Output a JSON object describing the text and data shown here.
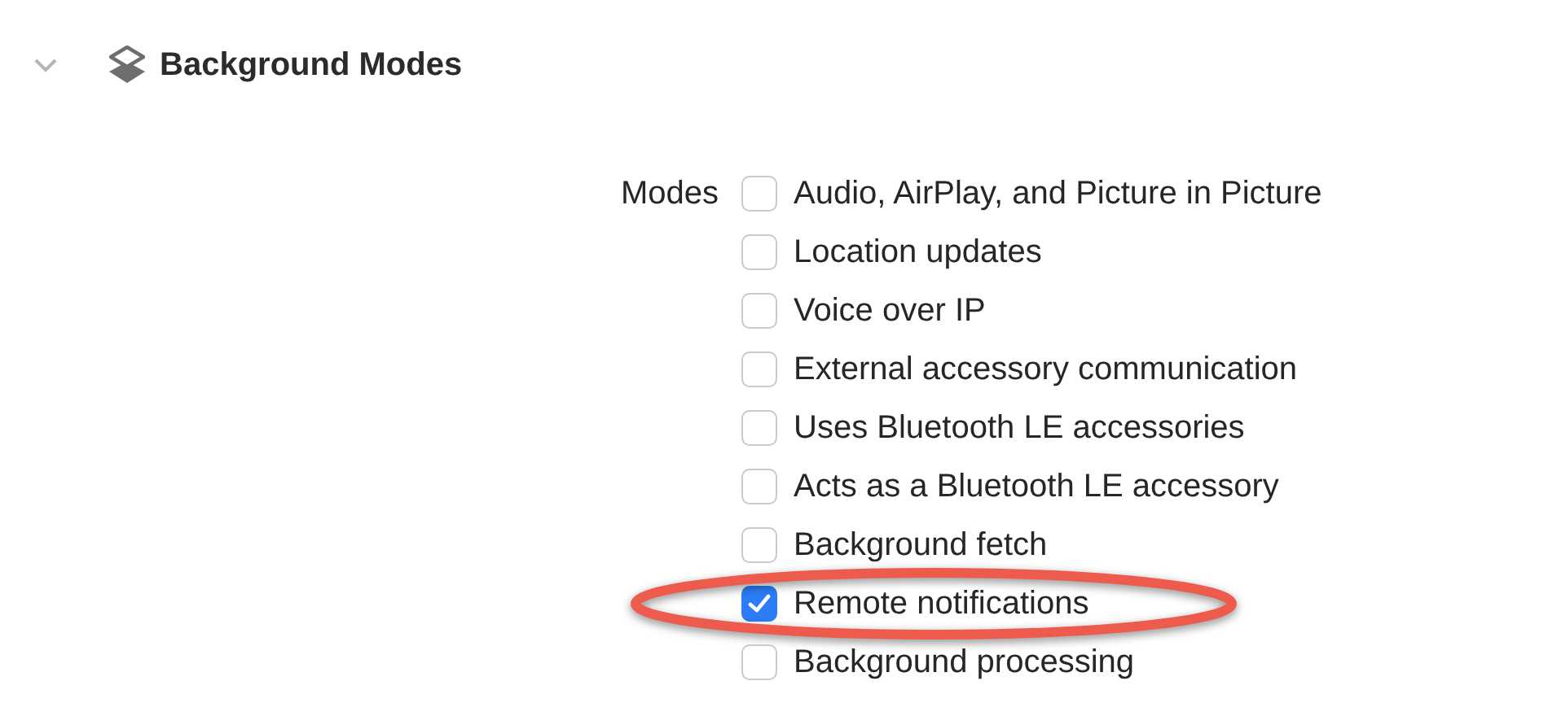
{
  "section": {
    "title": "Background Modes",
    "expanded": true
  },
  "modes": {
    "label": "Modes",
    "options": [
      {
        "label": "Audio, AirPlay, and Picture in Picture",
        "checked": false,
        "highlighted": false
      },
      {
        "label": "Location updates",
        "checked": false,
        "highlighted": false
      },
      {
        "label": "Voice over IP",
        "checked": false,
        "highlighted": false
      },
      {
        "label": "External accessory communication",
        "checked": false,
        "highlighted": false
      },
      {
        "label": "Uses Bluetooth LE accessories",
        "checked": false,
        "highlighted": false
      },
      {
        "label": "Acts as a Bluetooth LE accessory",
        "checked": false,
        "highlighted": false
      },
      {
        "label": "Background fetch",
        "checked": false,
        "highlighted": false
      },
      {
        "label": "Remote notifications",
        "checked": true,
        "highlighted": true
      },
      {
        "label": "Background processing",
        "checked": false,
        "highlighted": false
      }
    ]
  }
}
